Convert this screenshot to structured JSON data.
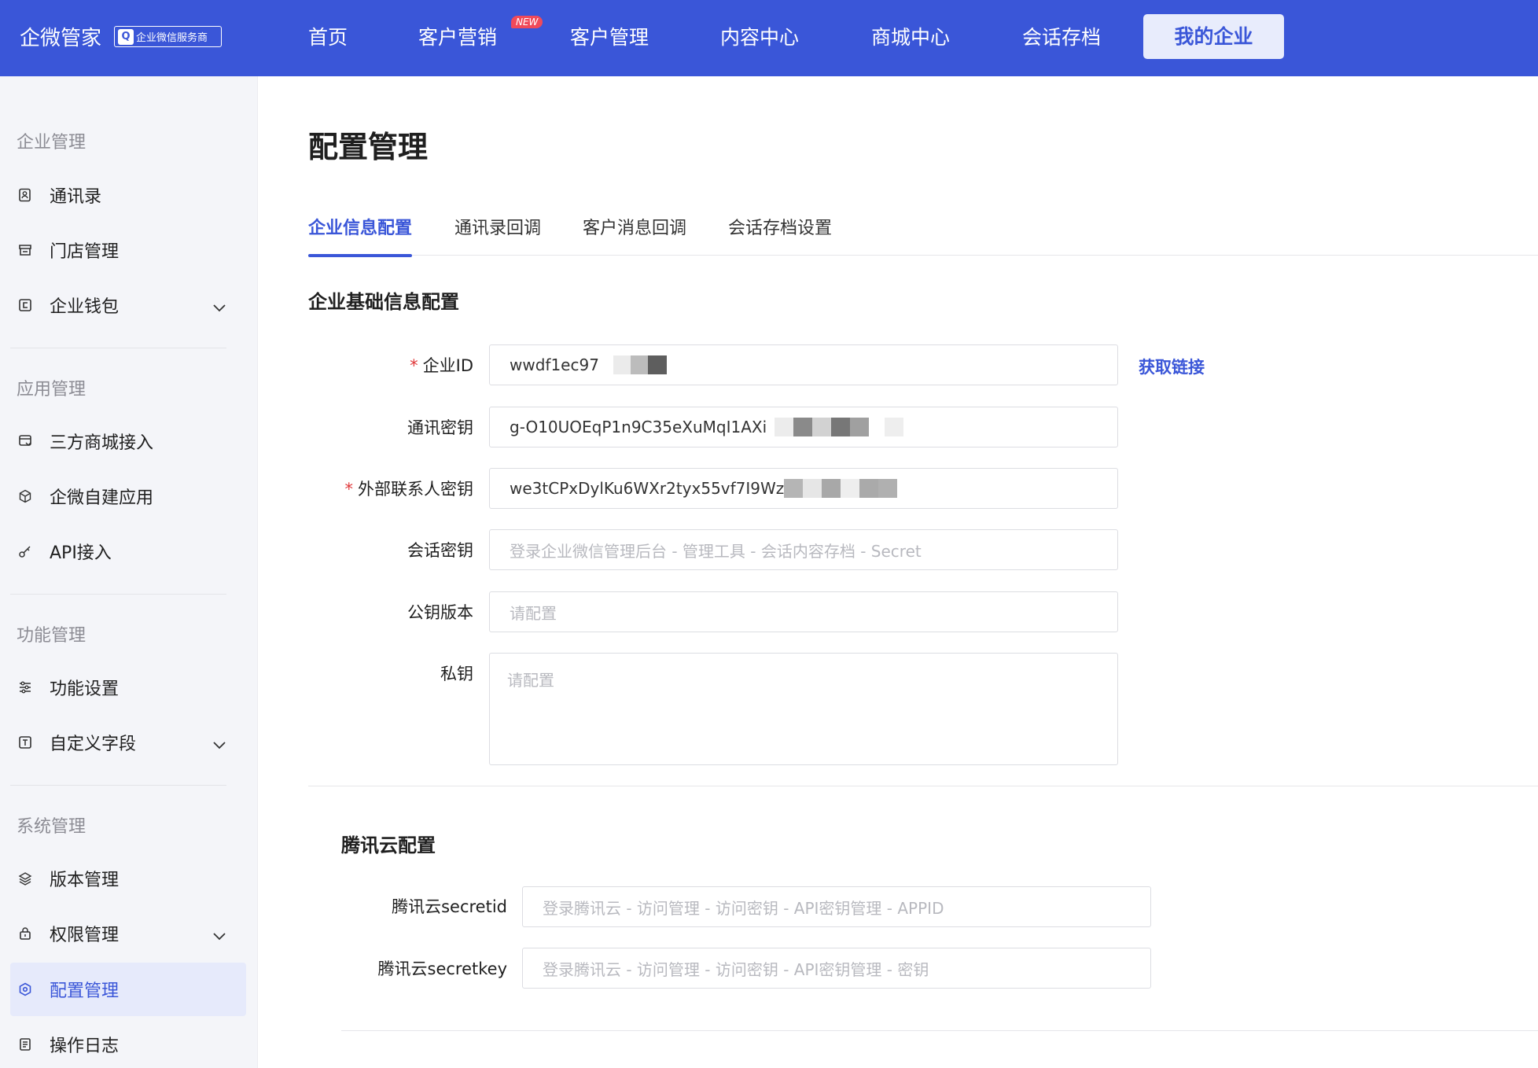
{
  "header": {
    "brand": "企微管家",
    "brand_badge": "企业微信服务商",
    "nav": [
      "首页",
      "客户营销",
      "客户管理",
      "内容中心",
      "商城中心",
      "会话存档",
      "我的企业"
    ],
    "new_tag": "NEW",
    "active_nav": "我的企业"
  },
  "sidebar": {
    "sections": [
      {
        "title": "企业管理",
        "items": [
          "通讯录",
          "门店管理",
          "企业钱包"
        ]
      },
      {
        "title": "应用管理",
        "items": [
          "三方商城接入",
          "企微自建应用",
          "API接入"
        ]
      },
      {
        "title": "功能管理",
        "items": [
          "功能设置",
          "自定义字段"
        ]
      },
      {
        "title": "系统管理",
        "items": [
          "版本管理",
          "权限管理",
          "配置管理",
          "操作日志"
        ]
      }
    ],
    "active_item": "配置管理"
  },
  "main": {
    "title": "配置管理",
    "tabs": [
      "企业信息配置",
      "通讯录回调",
      "客户消息回调",
      "会话存档设置"
    ],
    "basic_section": {
      "title": "企业基础信息配置",
      "fields": [
        {
          "label": "企业ID",
          "required": true,
          "value": "wwdf1ec97",
          "placeholder": ""
        },
        {
          "label": "通讯密钥",
          "required": false,
          "value": "g-O10UOEqP1n9C35eXuMqI1AXi",
          "placeholder": ""
        },
        {
          "label": "外部联系人密钥",
          "required": true,
          "value": "we3tCPxDylKu6WXr2tyx55vf7I9Wz",
          "placeholder": ""
        },
        {
          "label": "会话密钥",
          "required": false,
          "value": "",
          "placeholder": "登录企业微信管理后台 - 管理工具 - 会话内容存档 - Secret"
        },
        {
          "label": "公钥版本",
          "required": false,
          "value": "",
          "placeholder": "请配置"
        },
        {
          "label": "私钥",
          "required": false,
          "value": "",
          "placeholder": "请配置"
        }
      ],
      "get_link": "获取链接"
    },
    "tencent_section": {
      "title": "腾讯云配置",
      "fields": [
        {
          "label": "腾讯云secretid",
          "placeholder": "登录腾讯云 - 访问管理 - 访问密钥 - API密钥管理 - APPID"
        },
        {
          "label": "腾讯云secretkey",
          "placeholder": "登录腾讯云 - 访问管理 - 访问密钥  - API密钥管理 - 密钥"
        }
      ]
    }
  },
  "colors": {
    "primary": "#3a56d8",
    "required": "#e0383a",
    "new_tag": "#f04a5a"
  }
}
